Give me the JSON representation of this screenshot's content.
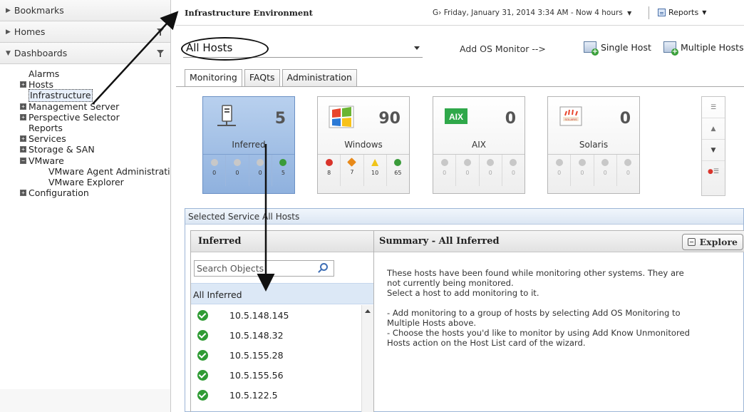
{
  "nav": {
    "bookmarks": "Bookmarks",
    "homes": "Homes",
    "dashboards": "Dashboards",
    "tree": [
      {
        "label": "Alarms",
        "type": "leaf"
      },
      {
        "label": "Hosts",
        "type": "expandable"
      },
      {
        "label": "Infrastructure",
        "type": "leaf",
        "selected": true
      },
      {
        "label": "Management Server",
        "type": "expandable"
      },
      {
        "label": "Perspective Selector",
        "type": "expandable"
      },
      {
        "label": "Reports",
        "type": "leaf"
      },
      {
        "label": "Services",
        "type": "expandable"
      },
      {
        "label": "Storage & SAN",
        "type": "expandable"
      },
      {
        "label": "VMware",
        "type": "expanded"
      },
      {
        "label": "VMware Agent Administrati",
        "type": "sub"
      },
      {
        "label": "VMware Explorer",
        "type": "sub"
      },
      {
        "label": "Configuration",
        "type": "expandable"
      }
    ]
  },
  "header": {
    "title": "Infrastructure Environment",
    "timerange": "Friday, January 31, 2014 3:34 AM - Now 4 hours",
    "reports": "Reports"
  },
  "toolbar": {
    "host_select": "All Hosts",
    "add_os_monitor": "Add OS Monitor -->",
    "single_host": "Single Host",
    "multiple_hosts": "Multiple Hosts"
  },
  "tabs": [
    "Monitoring",
    "FAQts",
    "Administration"
  ],
  "tiles": [
    {
      "name": "Inferred",
      "count": "5",
      "stats": [
        "0",
        "0",
        "0",
        "5"
      ],
      "selected": true
    },
    {
      "name": "Windows",
      "count": "90",
      "stats": [
        "8",
        "7",
        "10",
        "65"
      ]
    },
    {
      "name": "AIX",
      "count": "0",
      "stats": [
        "0",
        "0",
        "0",
        "0"
      ]
    },
    {
      "name": "Solaris",
      "count": "0",
      "stats": [
        "0",
        "0",
        "0",
        "0"
      ]
    }
  ],
  "service": {
    "header": "Selected Service All Hosts",
    "list_title": "Inferred",
    "search_placeholder": "Search Objects",
    "all_label": "All Inferred",
    "hosts": [
      "10.5.148.145",
      "10.5.148.32",
      "10.5.155.28",
      "10.5.155.56",
      "10.5.122.5"
    ],
    "summary_title": "Summary - All Inferred",
    "explore": "Explore",
    "summary_lines": [
      "These hosts have been found while monitoring other systems. They are",
      "not currently being monitored.",
      "Select a host to add monitoring to it.",
      "",
      "- Add monitoring to a group of hosts by selecting Add OS Monitoring to",
      "Multiple Hosts above.",
      "- Choose the hosts you'd like to monitor by using Add Know Unmonitored",
      "Hosts action on the Host List card of the wizard."
    ]
  },
  "colors": {
    "selected_tile": "#9dbce4",
    "ok": "#2f9b34",
    "critical": "#d9342b",
    "major": "#e88a1a",
    "warning": "#f0c419"
  }
}
